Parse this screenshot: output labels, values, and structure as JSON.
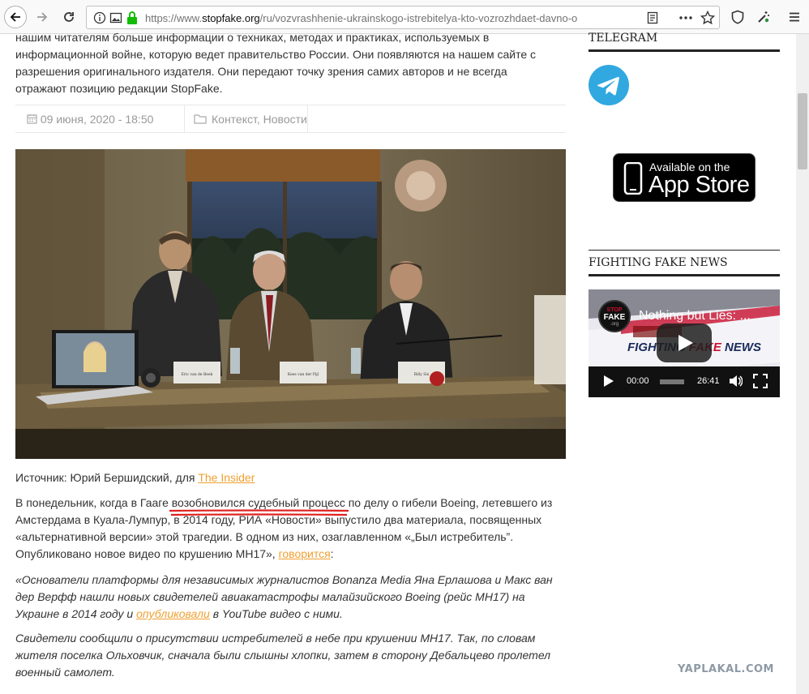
{
  "browser": {
    "url_prefix": "https://www.",
    "url_domain": "stopfake.org",
    "url_path": "/ru/vozvrashhenie-ukrainskogo-istrebitelya-kto-vozrozhdaet-davno-o"
  },
  "article": {
    "intro_lines": [
      "нашим читателям больше информации о техниках, методах и практиках, используемых в",
      "информационной войне, которую ведет правительство России. Они появляются на нашем сайте с",
      "разрешения оригинального издателя. Они передают точку зрения самих авторов и не всегда",
      "отражают позицию редакции StopFake."
    ],
    "date": "09 июня, 2020 - 18:50",
    "category_1": "Контекст",
    "category_sep": ", ",
    "category_2": "Новости",
    "photo_nameplates": [
      "Eric van de Beek",
      "Kees van der Pijl",
      "Billy Six"
    ],
    "caption_prefix": "Источник: Юрий Бершидский, для ",
    "caption_link": "The Insider",
    "p1_a": "В понедельник, когда в Гааге ",
    "p1_b": "возобновился судебный процесс",
    "p1_c": " по делу о гибели Boeing, летевшего из",
    "p1_line2": "Амстердама в Куала-Лумпур, в 2014 году, РИА «Новости» выпустило два материала, посвященных",
    "p1_line3": "«альтернативной версии» этой трагедии. В одном из них, озаглавленном «„Был истребитель”.",
    "p1_line4a": "Опубликовано новое видео по крушению МН17», ",
    "p1_link": "говорится",
    "p1_line4b": ":",
    "q1_line1": "«Основатели платформы для независимых журналистов Bonanza Media Яна Ерлашова и Макс ван",
    "q1_line2": "дер Верфф нашли новых свидетелей авиакатастрофы малайзийского Boeing (рейс МН17) на",
    "q1_line3a": "Украине в 2014 году и ",
    "q1_link": "опубликовали",
    "q1_line3b": " в YouTube видео с ними.",
    "q2_line1": "Свидетели сообщили о присутствии истребителей в небе при крушении МН17. Так, по словам",
    "q2_line2": "жителя поселка Ольховчик, сначала были слышны хлопки, затем в сторону Дебальцево пролетел",
    "q2_line3": "военный самолет."
  },
  "sidebar": {
    "telegram_title": "TELEGRAM",
    "appstore_small": "Available on the",
    "appstore_big": "App Store",
    "fighting_title": "FIGHTING FAKE NEWS",
    "video_title": "Nothing but Lies: ...",
    "video_logo_top": "STOP",
    "video_logo_mid": "FAKE",
    "video_logo_bot": ".org",
    "video_banner_a": "FIGHTING ",
    "video_banner_b": "FAKE",
    "video_banner_c": " NEWS",
    "video_current": "00:00",
    "video_duration": "26:41"
  },
  "watermark": "YAPLAKAL.COM",
  "colors": {
    "link": "#f0a030",
    "underline": "#e02020",
    "telegram": "#31a8e0"
  }
}
